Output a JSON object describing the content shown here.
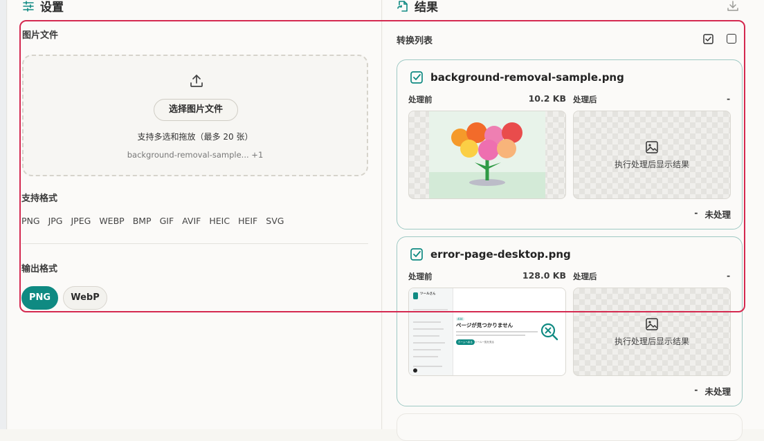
{
  "settings": {
    "title": "设置",
    "image_files_label": "图片文件",
    "choose_button": "选择图片文件",
    "drop_hint": "支持多选和拖放（最多 20 张）",
    "selected_files": "background-removal-sample... +1",
    "supported_formats_label": "支持格式",
    "formats": [
      "PNG",
      "JPG",
      "JPEG",
      "WEBP",
      "BMP",
      "GIF",
      "AVIF",
      "HEIC",
      "HEIF",
      "SVG"
    ],
    "output_format_label": "输出格式",
    "output_options": [
      {
        "label": "PNG",
        "selected": true
      },
      {
        "label": "WebP",
        "selected": false
      }
    ]
  },
  "results": {
    "title": "结果",
    "list_label": "转换列表",
    "items": [
      {
        "filename": "background-removal-sample.png",
        "before_label": "处理前",
        "size": "10.2 KB",
        "after_label": "处理后",
        "after_size": "-",
        "after_placeholder": "执行处理后显示结果",
        "status_dash": "-",
        "status": "未处理"
      },
      {
        "filename": "error-page-desktop.png",
        "before_label": "处理前",
        "size": "128.0 KB",
        "after_label": "处理后",
        "after_size": "-",
        "after_placeholder": "执行处理后显示结果",
        "status_dash": "-",
        "status": "未处理",
        "thumb": {
          "brand": "ツールさん",
          "heading": "ページが見つかりません",
          "tag": "404",
          "btn1": "ホームへ戻る",
          "btn2": "ツール一覧を見る"
        }
      }
    ]
  },
  "colors": {
    "accent": "#0f8a82",
    "highlight": "#d4284f",
    "card_border": "#9ec9c4"
  }
}
